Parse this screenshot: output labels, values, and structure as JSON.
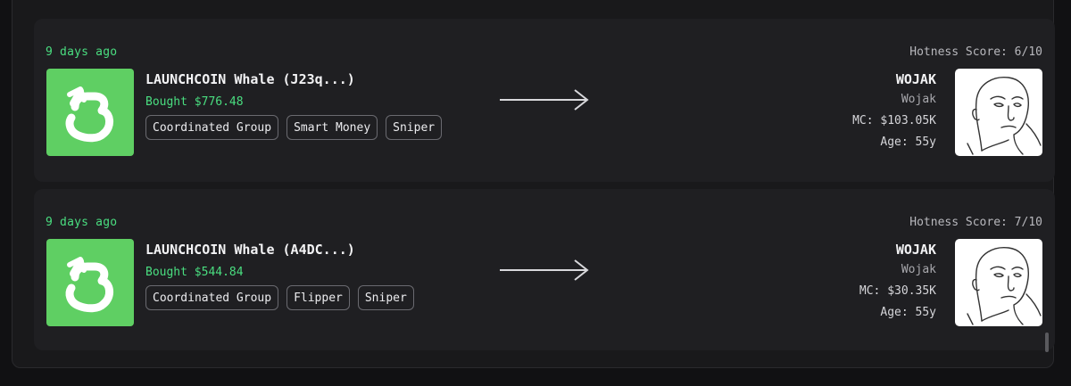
{
  "feed": [
    {
      "time_ago": "9 days ago",
      "hotness": "Hotness Score: 6/10",
      "wallet_name": "LAUNCHCOIN Whale (J23q...)",
      "bought": "Bought $776.48",
      "tags": [
        "Coordinated Group",
        "Smart Money",
        "Sniper"
      ],
      "token_symbol": "WOJAK",
      "token_name": "Wojak",
      "market_cap": "MC: $103.05K",
      "age": "Age: 55y"
    },
    {
      "time_ago": "9 days ago",
      "hotness": "Hotness Score: 7/10",
      "wallet_name": "LAUNCHCOIN Whale (A4DC...)",
      "bought": "Bought $544.84",
      "tags": [
        "Coordinated Group",
        "Flipper",
        "Sniper"
      ],
      "token_symbol": "WOJAK",
      "token_name": "Wojak",
      "market_cap": "MC: $30.35K",
      "age": "Age: 55y"
    }
  ],
  "colors": {
    "accent_green": "#4ade80",
    "logo_green": "#5fcf63",
    "card_bg": "#1f1f22"
  },
  "icons": {
    "wallet_logo": "launchcoin-logo-icon",
    "arrow": "arrow-right-icon",
    "token_image": "wojak-face-icon"
  }
}
